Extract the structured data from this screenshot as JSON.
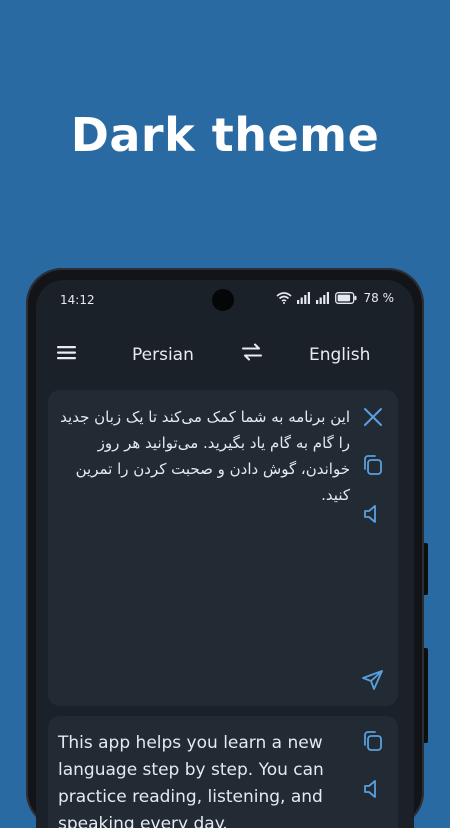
{
  "promo": {
    "headline": "Dark theme"
  },
  "status_bar": {
    "time": "14:12",
    "battery": "78 %"
  },
  "app_bar": {
    "source_language": "Persian",
    "target_language": "English"
  },
  "source_card": {
    "text": "این برنامه به شما کمک می‌کند تا یک زبان جدید را گام به گام یاد بگیرید. می‌توانید هر روز خواندن، گوش دادن و صحبت کردن را تمرین کنید."
  },
  "target_card": {
    "text": "This app helps you learn a new language step by step. You can practice reading, listening, and speaking every day."
  },
  "colors": {
    "background": "#2a6aa3",
    "screen": "#1b2129",
    "card": "#222a34",
    "accent_icon": "#5a9fe0"
  },
  "icons": [
    "menu-icon",
    "swap-icon",
    "close-icon",
    "copy-icon",
    "speaker-icon",
    "send-icon"
  ]
}
